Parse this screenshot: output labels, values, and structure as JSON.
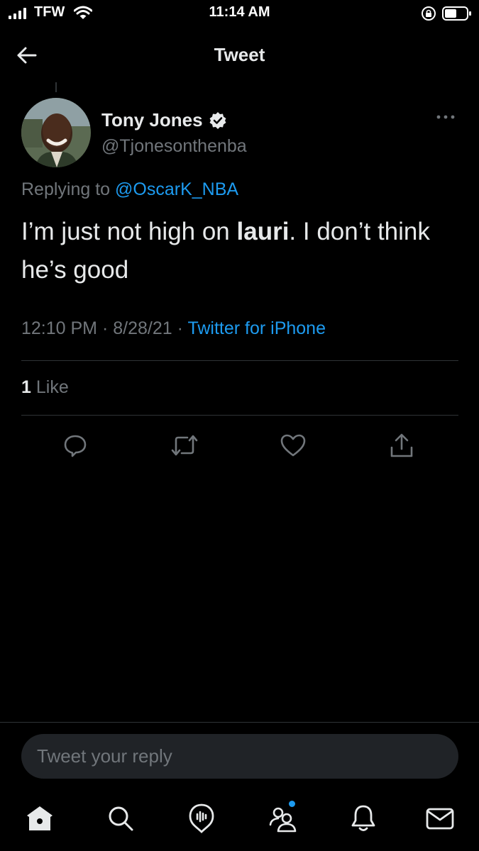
{
  "status_bar": {
    "carrier": "TFW",
    "time": "11:14 AM"
  },
  "header": {
    "title": "Tweet"
  },
  "tweet": {
    "author_name": "Tony Jones",
    "author_handle": "@Tjonesonthenba",
    "verified": true,
    "replying_prefix": "Replying to",
    "replying_to": "@OscarK_NBA",
    "text_before": "I’m just not high on ",
    "text_bold": "lauri",
    "text_after": ". I don’t think he’s good",
    "time": "12:10 PM",
    "date": "8/28/21",
    "separator": "·",
    "source": "Twitter for iPhone",
    "like_count": "1",
    "like_label": "Like"
  },
  "reply": {
    "placeholder": "Tweet your reply"
  },
  "colors": {
    "background": "#000000",
    "accent": "#1d9bf0",
    "secondary_text": "#71767b",
    "divider": "#2f3336"
  },
  "icons": {
    "actions": [
      "reply-icon",
      "retweet-icon",
      "like-icon",
      "share-icon"
    ],
    "tabs": [
      "home-icon",
      "search-icon",
      "spaces-icon",
      "communities-icon",
      "notifications-icon",
      "messages-icon"
    ]
  }
}
